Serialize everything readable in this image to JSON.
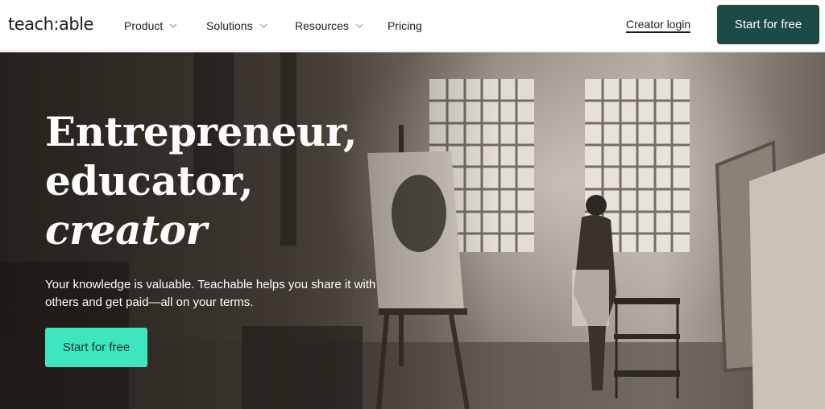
{
  "header": {
    "logo": "teach:able",
    "nav": [
      {
        "label": "Product",
        "has_dropdown": true
      },
      {
        "label": "Solutions",
        "has_dropdown": true
      },
      {
        "label": "Resources",
        "has_dropdown": true
      },
      {
        "label": "Pricing",
        "has_dropdown": false
      }
    ],
    "login_label": "Creator login",
    "cta_label": "Start for free"
  },
  "hero": {
    "headline_line1": "Entrepreneur,",
    "headline_line2": "educator,",
    "headline_line3": "creator",
    "subtext": "Your knowledge is valuable. Teachable helps you share it with others and get paid—all on your terms.",
    "cta_label": "Start for free",
    "image": "artist-studio-photo"
  },
  "colors": {
    "primary_dark": "#1e4a45",
    "accent_mint": "#3ee6c0",
    "text": "#1c1c1c"
  }
}
